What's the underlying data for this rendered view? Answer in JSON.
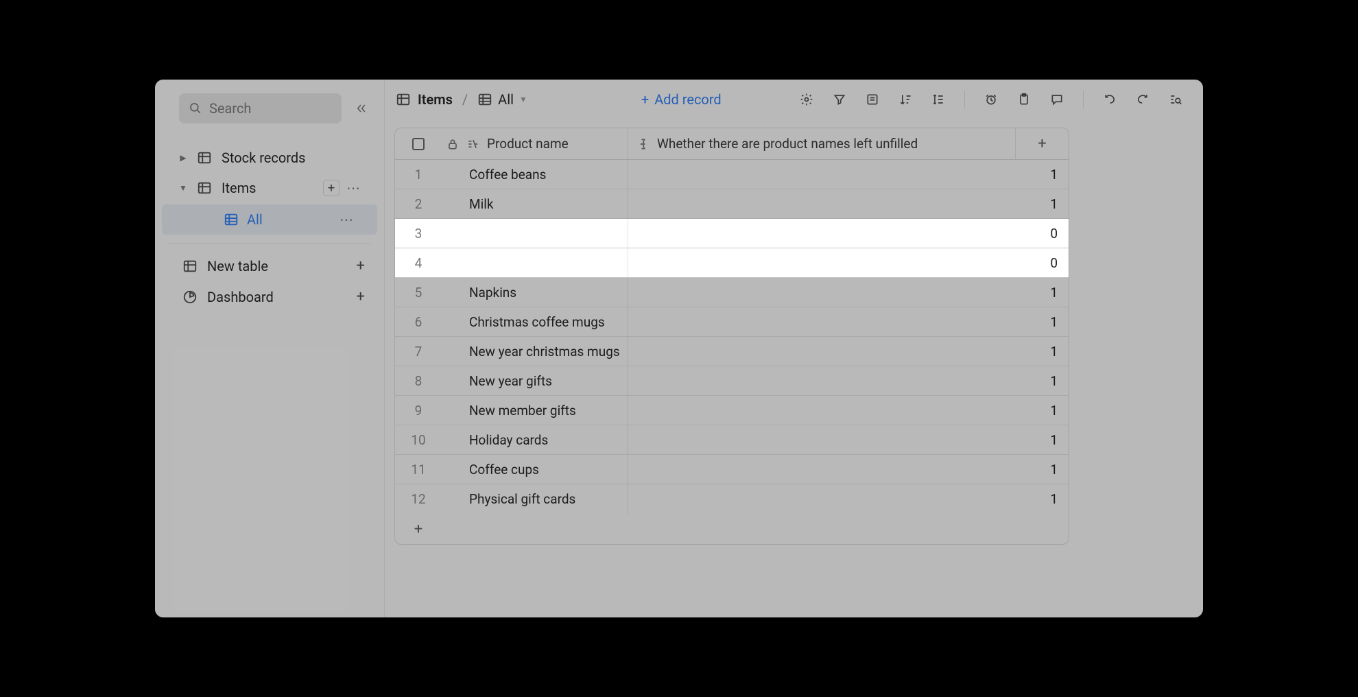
{
  "sidebar": {
    "search_placeholder": "Search",
    "tables": [
      {
        "label": "Stock records",
        "expanded": false
      },
      {
        "label": "Items",
        "expanded": true
      }
    ],
    "active_view_label": "All",
    "new_table_label": "New table",
    "dashboard_label": "Dashboard"
  },
  "header": {
    "table_label": "Items",
    "view_label": "All",
    "add_record_label": "Add record"
  },
  "columns": {
    "product_name": "Product name",
    "unfilled_check": "Whether there are product names left unfilled"
  },
  "rows": [
    {
      "n": "1",
      "name": "Coffee beans",
      "val": "1",
      "hl": false
    },
    {
      "n": "2",
      "name": "Milk",
      "val": "1",
      "hl": false
    },
    {
      "n": "3",
      "name": "",
      "val": "0",
      "hl": true
    },
    {
      "n": "4",
      "name": "",
      "val": "0",
      "hl": true
    },
    {
      "n": "5",
      "name": "Napkins",
      "val": "1",
      "hl": false
    },
    {
      "n": "6",
      "name": "Christmas coffee mugs",
      "val": "1",
      "hl": false
    },
    {
      "n": "7",
      "name": "New year christmas mugs",
      "val": "1",
      "hl": false
    },
    {
      "n": "8",
      "name": "New year gifts",
      "val": "1",
      "hl": false
    },
    {
      "n": "9",
      "name": "New member gifts",
      "val": "1",
      "hl": false
    },
    {
      "n": "10",
      "name": "Holiday cards",
      "val": "1",
      "hl": false
    },
    {
      "n": "11",
      "name": "Coffee cups",
      "val": "1",
      "hl": false
    },
    {
      "n": "12",
      "name": "Physical gift cards",
      "val": "1",
      "hl": false
    }
  ]
}
